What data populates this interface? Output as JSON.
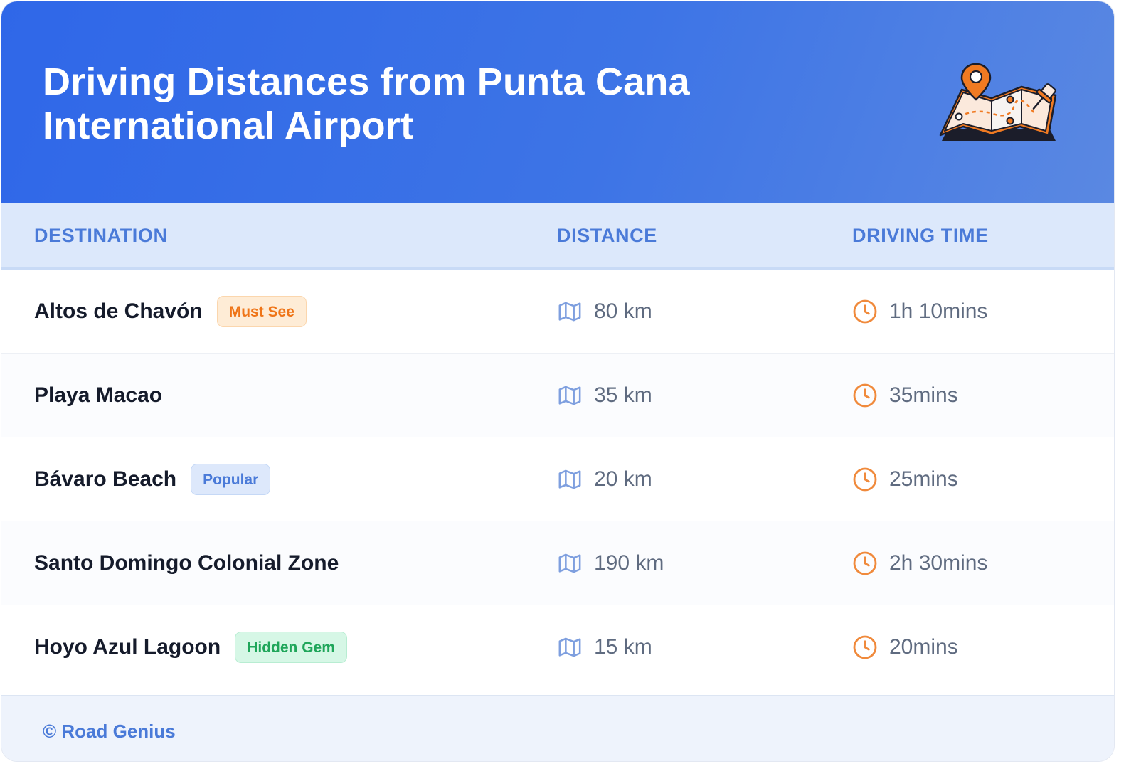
{
  "header": {
    "title_line1": "Driving Distances from Punta Cana",
    "title_line2": "International Airport",
    "illustration_icon": "map-with-pin-icon"
  },
  "table": {
    "columns": [
      "DESTINATION",
      "DISTANCE",
      "DRIVING TIME"
    ],
    "distance_icon": "map-icon",
    "time_icon": "clock-icon",
    "rows": [
      {
        "destination": "Altos de Chavón",
        "badge": "Must See",
        "badge_color": "#ef7518",
        "distance": "80 km",
        "time": "1h 10mins"
      },
      {
        "destination": "Playa Macao",
        "badge": "",
        "badge_color": "",
        "distance": "35 km",
        "time": "35mins"
      },
      {
        "destination": "Bávaro Beach",
        "badge": "Popular",
        "badge_color": "#4a7ad8",
        "distance": "20 km",
        "time": "25mins"
      },
      {
        "destination": "Santo Domingo Colonial Zone",
        "badge": "",
        "badge_color": "",
        "distance": "190 km",
        "time": "2h 30mins"
      },
      {
        "destination": "Hoyo Azul Lagoon",
        "badge": "Hidden Gem",
        "badge_color": "#1fa65a",
        "distance": "15 km",
        "time": "20mins"
      }
    ]
  },
  "footer": {
    "credit": "© Road Genius"
  },
  "colors": {
    "header_gradient_start": "#2f67e8",
    "header_gradient_end": "#5a88e2",
    "accent_blue": "#4a7ad8",
    "accent_orange": "#f08a3c"
  }
}
